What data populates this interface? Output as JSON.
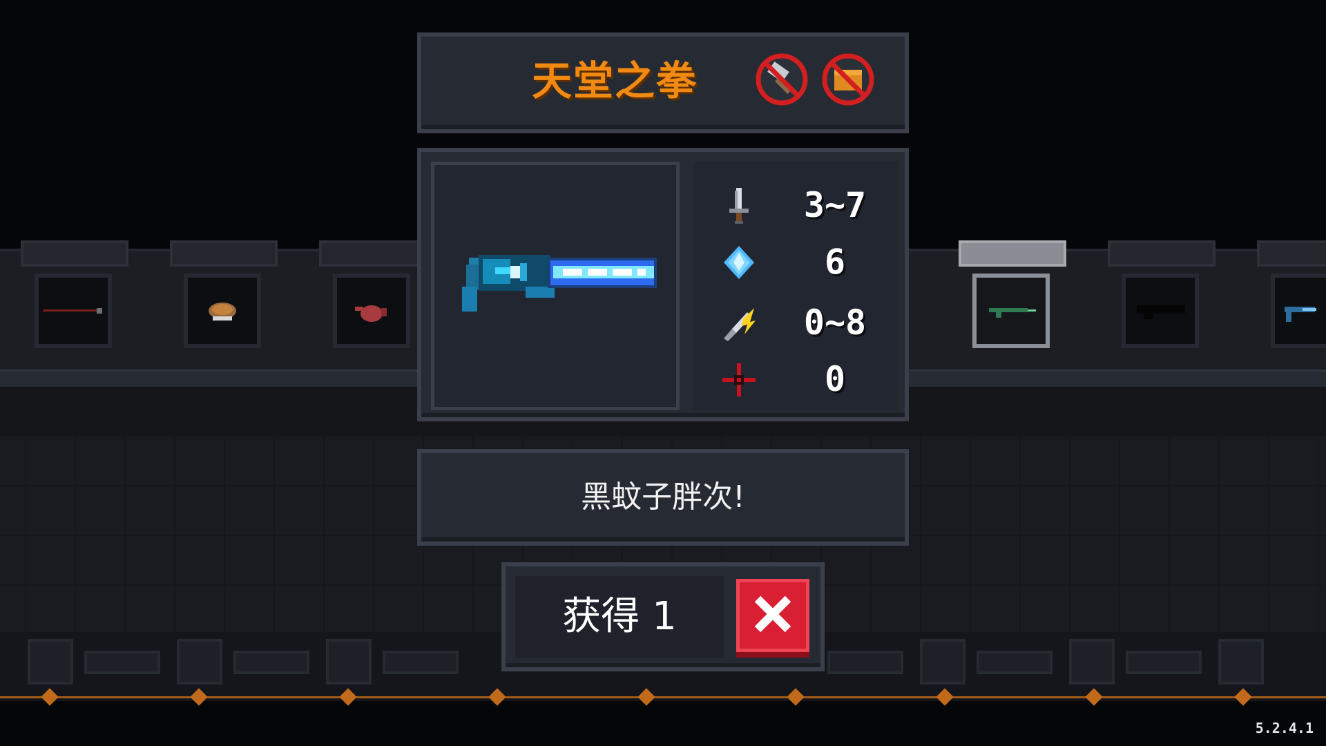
{
  "weapon": {
    "name": "天堂之拳",
    "description": "黑蚊子胖次!",
    "flags": [
      "no-upgrade-icon",
      "no-chest-icon"
    ],
    "accent_color": "#f08a12"
  },
  "stats": [
    {
      "icon": "sword-damage-icon",
      "value": "3~7"
    },
    {
      "icon": "energy-crystal-icon",
      "value": "6"
    },
    {
      "icon": "crit-chance-icon",
      "value": "0~8"
    },
    {
      "icon": "spread-crosshair-icon",
      "value": "0"
    }
  ],
  "actions": {
    "obtain_label": "获得 1",
    "close_icon": "close-x-icon",
    "close_color": "#d81f33"
  },
  "display_shelf": {
    "items": [
      "spear-icon",
      "food-bowl-icon",
      "teapot-icon",
      "empty-slot",
      "green-rifle-icon",
      "locked-silhouette-icon",
      "blue-gun-icon"
    ]
  },
  "version": "5.2.4.1"
}
